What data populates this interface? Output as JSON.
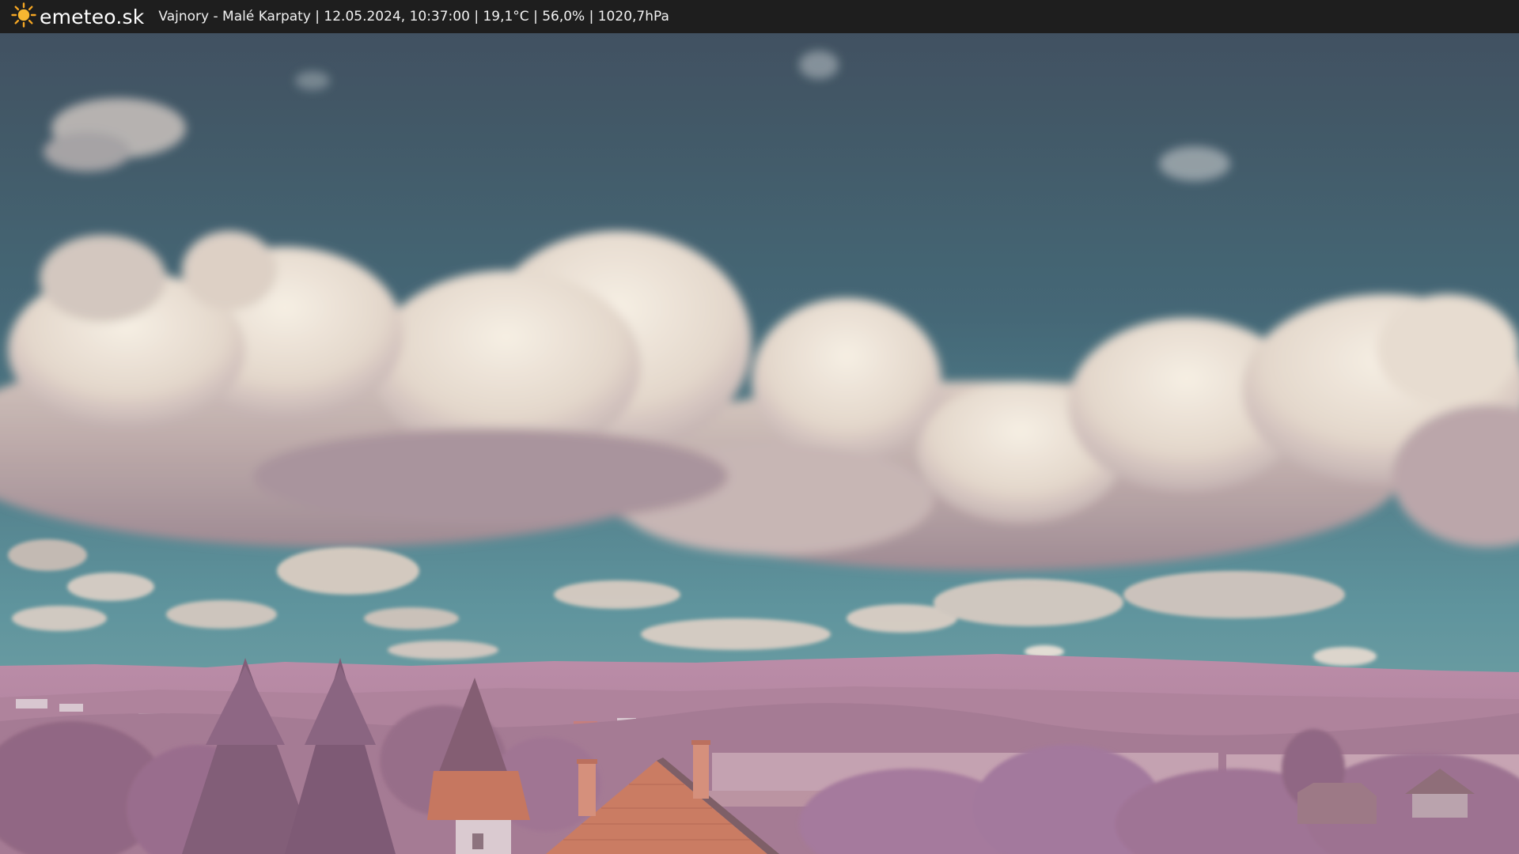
{
  "header": {
    "brand": "emeteo.sk",
    "caption": "Vajnory - Malé Karpaty | 12.05.2024, 10:37:00 | 19,1°C | 56,0% | 1020,7hPa"
  },
  "icons": {
    "logo": "sun-icon"
  },
  "colors": {
    "bar": "#1e1e1e",
    "sky_top": "#3c4f5f",
    "sky_bottom": "#4f8a96",
    "cloud": "#e8ddd2",
    "cloud_shade": "#a8949a",
    "hills": "#b78aa4",
    "foliage": "#9a6d89",
    "roof": "#c4725a"
  }
}
